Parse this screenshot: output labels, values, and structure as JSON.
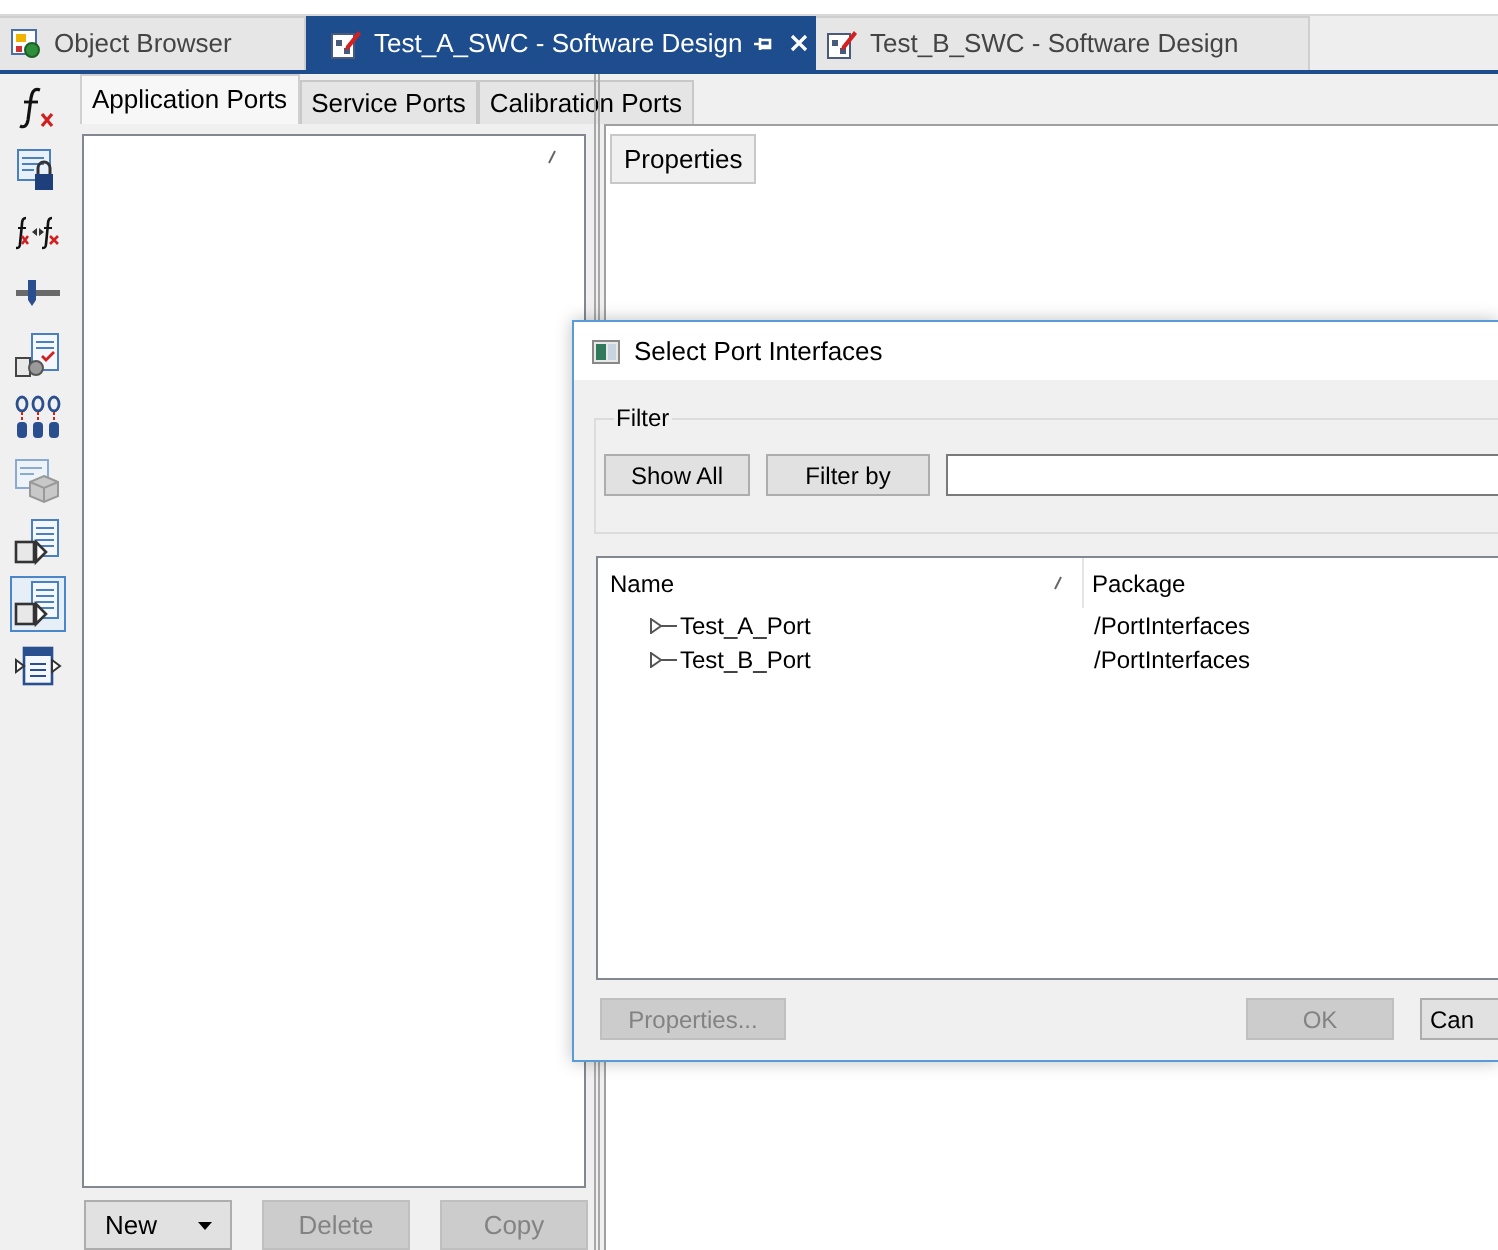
{
  "document_tabs": [
    {
      "label": "Object Browser",
      "selected": false,
      "kind": "browser"
    },
    {
      "label": "Test_A_SWC - Software Design",
      "selected": true,
      "kind": "design"
    },
    {
      "label": "Test_B_SWC - Software Design",
      "selected": false,
      "kind": "design"
    }
  ],
  "toolbar": {
    "items": [
      {
        "kind": "function",
        "selected": false
      },
      {
        "kind": "lock",
        "selected": false
      },
      {
        "kind": "compare",
        "selected": false
      },
      {
        "kind": "slider",
        "selected": false
      },
      {
        "kind": "check",
        "selected": false
      },
      {
        "kind": "chain",
        "selected": false
      },
      {
        "kind": "cube",
        "selected": false
      },
      {
        "kind": "export",
        "selected": false
      },
      {
        "kind": "export",
        "selected": true
      },
      {
        "kind": "frame",
        "selected": false
      }
    ]
  },
  "port_tabs": [
    {
      "label": "Application Ports",
      "selected": true
    },
    {
      "label": "Service Ports",
      "selected": false
    },
    {
      "label": "Calibration Ports",
      "selected": false
    }
  ],
  "port_list": {
    "sorted": true,
    "buttons": [
      {
        "label": "New",
        "kind": "dropdown",
        "disabled": false
      },
      {
        "label": "Delete",
        "kind": "plain",
        "disabled": true
      },
      {
        "label": "Copy",
        "kind": "plain",
        "disabled": true
      }
    ]
  },
  "properties_panel": {
    "tabs": [
      {
        "label": "Properties",
        "selected": true
      }
    ]
  },
  "dialog": {
    "title": "Select Port Interfaces",
    "filter": {
      "label": "Filter",
      "buttons": [
        "Show All",
        "Filter by"
      ]
    },
    "table": {
      "columns": [
        {
          "label": "Name",
          "sorted": true
        },
        {
          "label": "Package",
          "sorted": false
        }
      ],
      "rows": [
        {
          "name": "Test_A_Port",
          "package": "/PortInterfaces"
        },
        {
          "name": "Test_B_Port",
          "package": "/PortInterfaces"
        }
      ]
    },
    "buttons": [
      {
        "label": "Properties...",
        "disabled": true
      },
      {
        "label": "OK",
        "disabled": true
      },
      {
        "label": "Can",
        "disabled": false
      }
    ]
  }
}
